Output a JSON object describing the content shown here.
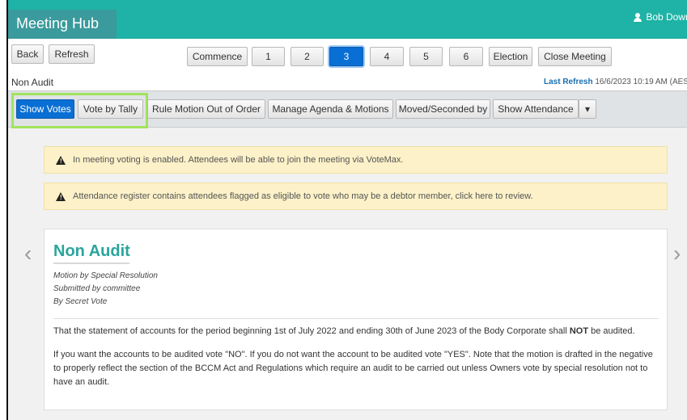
{
  "app": {
    "title": "Meeting Hub",
    "user": "Bob Dowr"
  },
  "nav": {
    "back": "Back",
    "refresh": "Refresh",
    "commence": "Commence",
    "steps": [
      "1",
      "2",
      "3",
      "4",
      "5",
      "6"
    ],
    "active_step": "3",
    "election": "Election",
    "close_meeting": "Close Meeting"
  },
  "info": {
    "motion_name": "Non Audit",
    "last_refresh_label": "Last Refresh",
    "last_refresh_value": "16/6/2023 10:19 AM (AES"
  },
  "actions": {
    "show_votes": "Show Votes",
    "vote_by_tally": "Vote by Tally",
    "rule_out_of_order": "Rule Motion Out of Order",
    "manage_agenda": "Manage Agenda & Motions",
    "moved_seconded": "Moved/Seconded by",
    "show_attendance": "Show Attendance",
    "dropdown_caret": "▾"
  },
  "alerts": [
    "In meeting voting is enabled. Attendees will be able to join the meeting via VoteMax.",
    "Attendance register contains attendees flagged as eligible to vote who may be a debtor member, click here to review."
  ],
  "motion": {
    "title": "Non Audit",
    "type": "Motion by Special Resolution",
    "submitted": "Submitted by committee",
    "vote_method": "By Secret Vote",
    "paragraph1_before": "That the statement of accounts for the period beginning 1st of July 2022 and ending 30th of June 2023 of the Body Corporate shall ",
    "paragraph1_bold": "NOT",
    "paragraph1_after": " be audited.",
    "paragraph2": "If you want the accounts to be audited vote \"NO\". If you do not want the account to be audited vote \"YES\". Note that the motion is drafted in the negative to properly reflect the section of the BCCM Act and Regulations which require an audit to be carried out unless Owners vote by special resolution not to have an audit."
  },
  "pager": {
    "prev": "‹",
    "next": "›"
  },
  "colors": {
    "header": "#1eb3a6",
    "brand_tab": "#3a9a9c",
    "primary": "#0a6fd4",
    "highlight": "#a2e35c",
    "title": "#2aa59c",
    "alert_bg": "#fcf1c8"
  }
}
